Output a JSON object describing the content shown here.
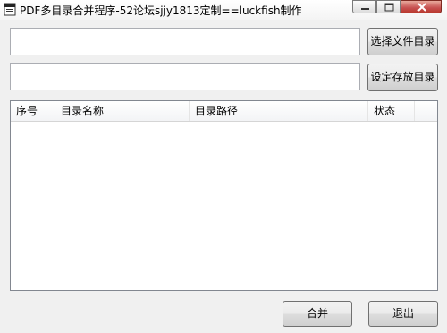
{
  "window": {
    "title": "PDF多目录合并程序-52论坛sjjy1813定制==luckfish制作"
  },
  "inputs": {
    "source_dir_value": "",
    "save_dir_value": ""
  },
  "buttons": {
    "choose_dir": "选择文件目录",
    "save_dir": "设定存放目录",
    "merge": "合并",
    "exit": "退出"
  },
  "list": {
    "columns": [
      "序号",
      "目录名称",
      "目录路径",
      "状态"
    ],
    "rows": []
  },
  "icons": {
    "app": "pdf-app-icon",
    "minimize": "minimize-icon",
    "maximize": "maximize-icon",
    "close": "close-icon"
  },
  "colors": {
    "close_button": "#c75050",
    "window_bg": "#f0f0f0"
  }
}
